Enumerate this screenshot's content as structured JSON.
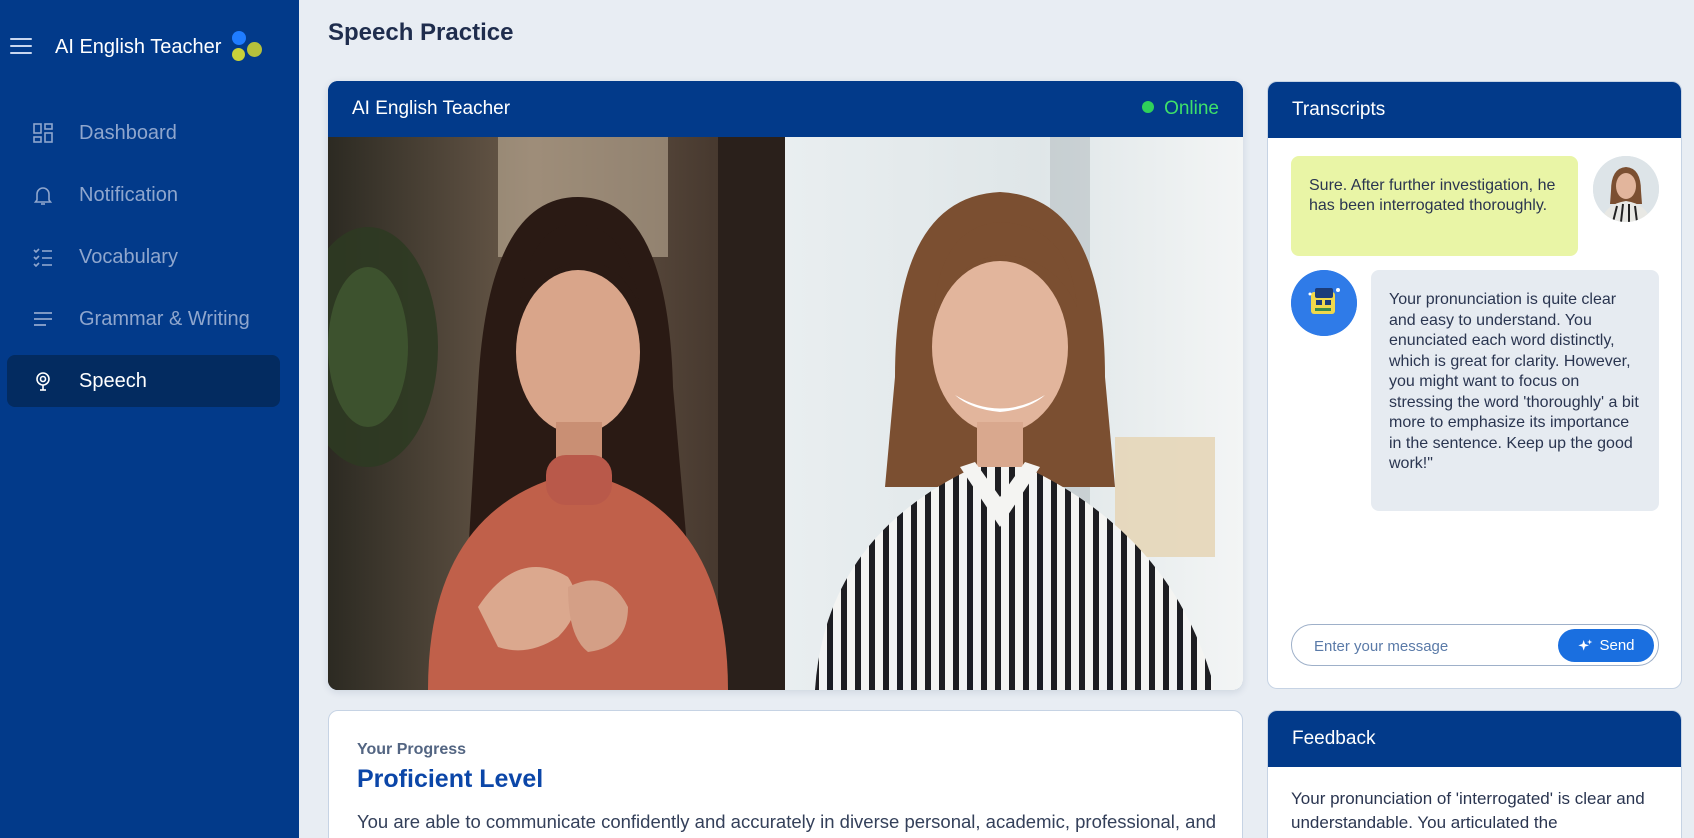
{
  "app": {
    "title": "AI English Teacher"
  },
  "sidebar": {
    "items": [
      {
        "label": "Dashboard",
        "icon": "dashboard-icon",
        "active": false
      },
      {
        "label": "Notification",
        "icon": "bell-icon",
        "active": false
      },
      {
        "label": "Vocabulary",
        "icon": "checklist-icon",
        "active": false
      },
      {
        "label": "Grammar & Writing",
        "icon": "text-lines-icon",
        "active": false
      },
      {
        "label": "Speech",
        "icon": "microphone-icon",
        "active": true
      }
    ]
  },
  "page": {
    "title": "Speech Practice"
  },
  "video": {
    "title": "AI English Teacher",
    "status": "Online"
  },
  "transcripts": {
    "title": "Transcripts",
    "messages": [
      {
        "from": "user",
        "text": "Sure. After further investigation, he has been interrogated thoroughly."
      },
      {
        "from": "bot",
        "text": "Your pronunciation is quite clear and easy to understand. You enunciated each word distinctly, which is great for clarity. However, you might want to focus on stressing the word 'thoroughly' a bit more to emphasize its importance in the sentence. Keep up the good work!\""
      }
    ],
    "input_placeholder": "Enter your message",
    "send_label": "Send"
  },
  "progress": {
    "kicker": "Your Progress",
    "level": "Proficient Level",
    "description": "You are able to communicate confidently and accurately in diverse personal, academic, professional, and social situations."
  },
  "feedback": {
    "title": "Feedback",
    "text": "Your pronunciation of 'interrogated' is clear and understandable. You articulated the"
  },
  "colors": {
    "sidebar": "#023a8a",
    "active_nav": "#032b60",
    "online": "#2fd15a",
    "user_bubble": "#e9f5a6",
    "send_button": "#1a6fe0"
  }
}
